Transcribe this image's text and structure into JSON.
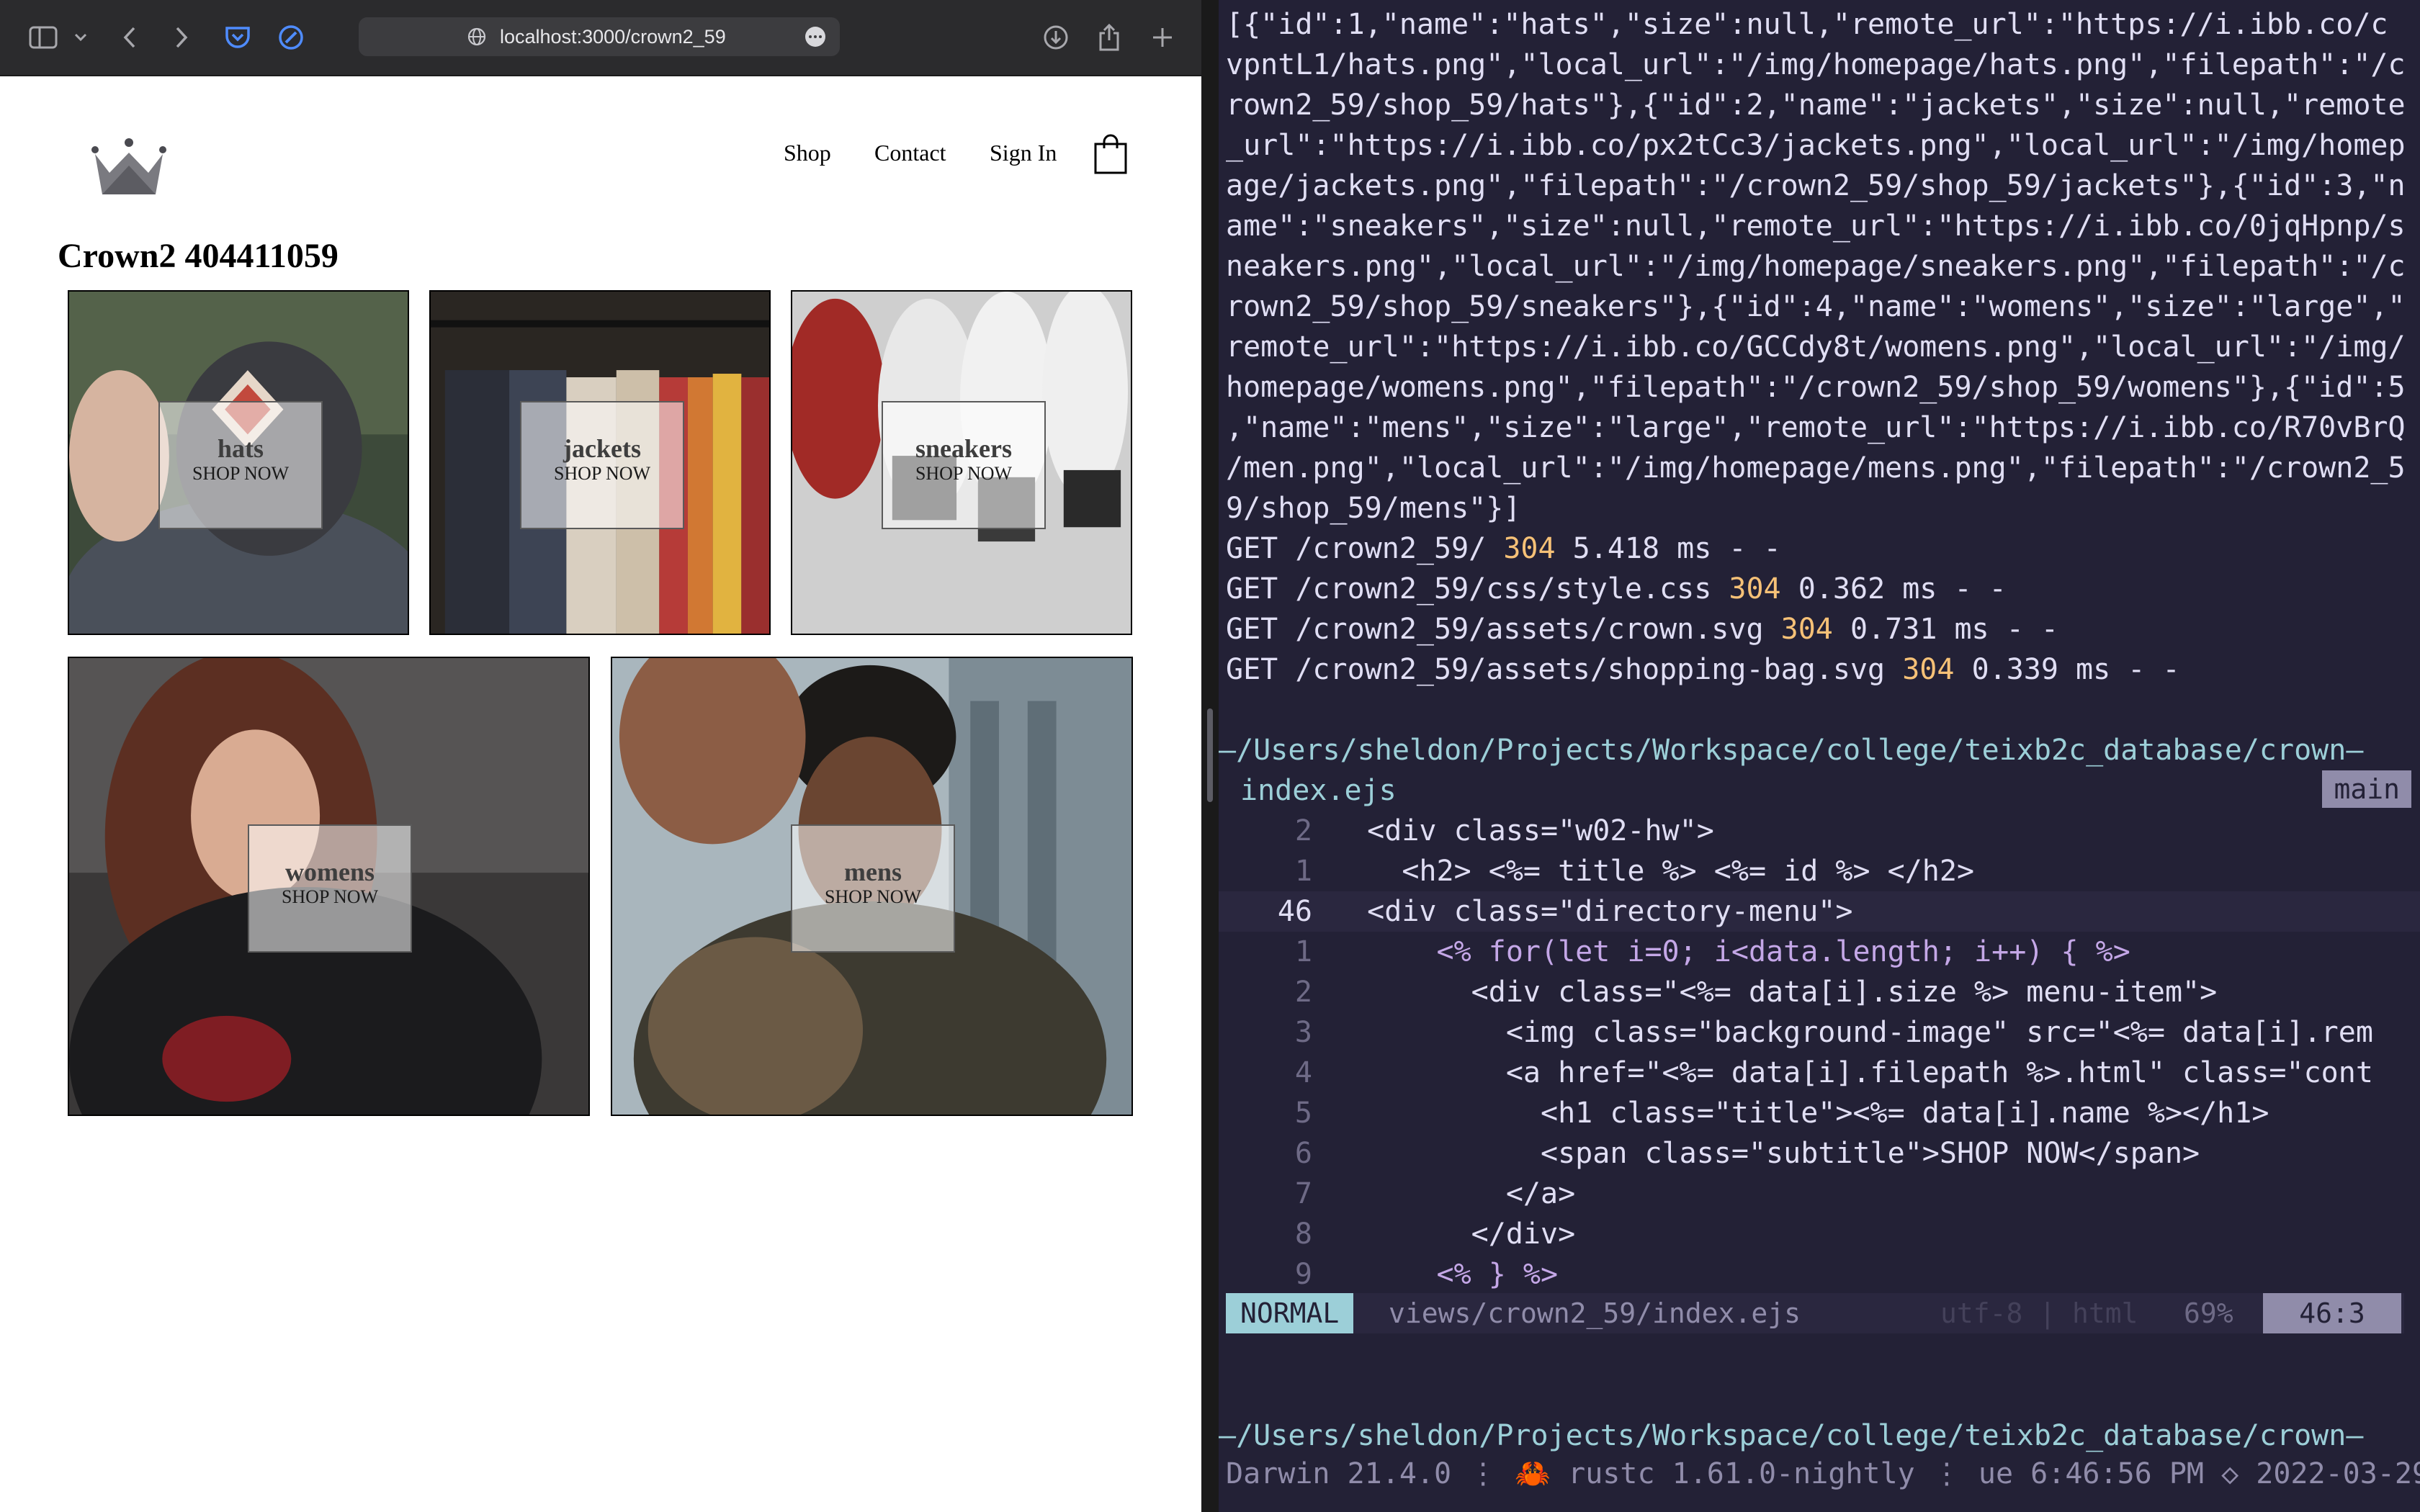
{
  "browser": {
    "url": "localhost:3000/crown2_59",
    "toolbar_icons": [
      "sidebar-icon",
      "chevron-down-icon",
      "back-icon",
      "forward-icon",
      "pocket-icon",
      "compass-icon",
      "download-icon",
      "share-icon",
      "new-tab-icon"
    ]
  },
  "site": {
    "nav": {
      "shop": "Shop",
      "contact": "Contact",
      "signin": "Sign In"
    },
    "title": "Crown2 404411059",
    "tiles": [
      {
        "name": "hats",
        "subtitle": "SHOP NOW"
      },
      {
        "name": "jackets",
        "subtitle": "SHOP NOW"
      },
      {
        "name": "sneakers",
        "subtitle": "SHOP NOW"
      },
      {
        "name": "womens",
        "subtitle": "SHOP NOW"
      },
      {
        "name": "mens",
        "subtitle": "SHOP NOW"
      }
    ]
  },
  "terminal": {
    "json_output": [
      "[{\"id\":1,\"name\":\"hats\",\"size\":null,\"remote_url\":\"https://i.ibb.co/c",
      "vpntL1/hats.png\",\"local_url\":\"/img/homepage/hats.png\",\"filepath\":\"/c",
      "rown2_59/shop_59/hats\"},{\"id\":2,\"name\":\"jackets\",\"size\":null,\"remote",
      "_url\":\"https://i.ibb.co/px2tCc3/jackets.png\",\"local_url\":\"/img/homep",
      "age/jackets.png\",\"filepath\":\"/crown2_59/shop_59/jackets\"},{\"id\":3,\"n",
      "ame\":\"sneakers\",\"size\":null,\"remote_url\":\"https://i.ibb.co/0jqHpnp/s",
      "neakers.png\",\"local_url\":\"/img/homepage/sneakers.png\",\"filepath\":\"/c",
      "rown2_59/shop_59/sneakers\"},{\"id\":4,\"name\":\"womens\",\"size\":\"large\",\"",
      "remote_url\":\"https://i.ibb.co/GCCdy8t/womens.png\",\"local_url\":\"/img/",
      "homepage/womens.png\",\"filepath\":\"/crown2_59/shop_59/womens\"},{\"id\":5",
      ",\"name\":\"mens\",\"size\":\"large\",\"remote_url\":\"https://i.ibb.co/R70vBrQ",
      "/men.png\",\"local_url\":\"/img/homepage/mens.png\",\"filepath\":\"/crown2_5",
      "9/shop_59/mens\"}]"
    ],
    "requests": [
      {
        "path": "GET /crown2_59/",
        "status": "304",
        "time": "5.418 ms - -"
      },
      {
        "path": "GET /crown2_59/css/style.css",
        "status": "304",
        "time": "0.362 ms - -"
      },
      {
        "path": "GET /crown2_59/assets/crown.svg",
        "status": "304",
        "time": "0.731 ms - -"
      },
      {
        "path": "GET /crown2_59/assets/shopping-bag.svg",
        "status": "304",
        "time": "0.339 ms - -"
      }
    ],
    "pane_path_top": "—/Users/sheldon/Projects/Workspace/college/teixb2c_database/crown—",
    "filename": "index.ejs",
    "branch": "main",
    "code_lines": [
      {
        "n": "2",
        "text": "  <div class=\"w02-hw\">"
      },
      {
        "n": "1",
        "text": "    <h2> <%= title %> <%= id %> </h2>"
      },
      {
        "n": "46",
        "text": "  <div class=\"directory-menu\">"
      },
      {
        "n": "1",
        "text": "      <% for(let i=0; i<data.length; i++) { %>"
      },
      {
        "n": "2",
        "text": "        <div class=\"<%= data[i].size %> menu-item\">"
      },
      {
        "n": "3",
        "text": "          <img class=\"background-image\" src=\"<%= data[i].rem"
      },
      {
        "n": "4",
        "text": "          <a href=\"<%= data[i].filepath %>.html\" class=\"cont"
      },
      {
        "n": "5",
        "text": "            <h1 class=\"title\"><%= data[i].name %></h1>"
      },
      {
        "n": "6",
        "text": "            <span class=\"subtitle\">SHOP NOW</span>"
      },
      {
        "n": "7",
        "text": "          </a>"
      },
      {
        "n": "8",
        "text": "        </div>"
      },
      {
        "n": "9",
        "text": "      <% } %>"
      }
    ],
    "status": {
      "mode": "NORMAL",
      "file": "views/crown2_59/index.ejs",
      "encoding": "utf-8 | html",
      "percent": "69%",
      "position": "46:3"
    },
    "pane_path_bottom": "—/Users/sheldon/Projects/Workspace/college/teixb2c_database/crown—",
    "bottom_bar": "Darwin 21.4.0 ⋮ 🦀 rustc 1.61.0-nightly ⋮ ue 6:46:56 PM ◇ 2022-03-29"
  }
}
